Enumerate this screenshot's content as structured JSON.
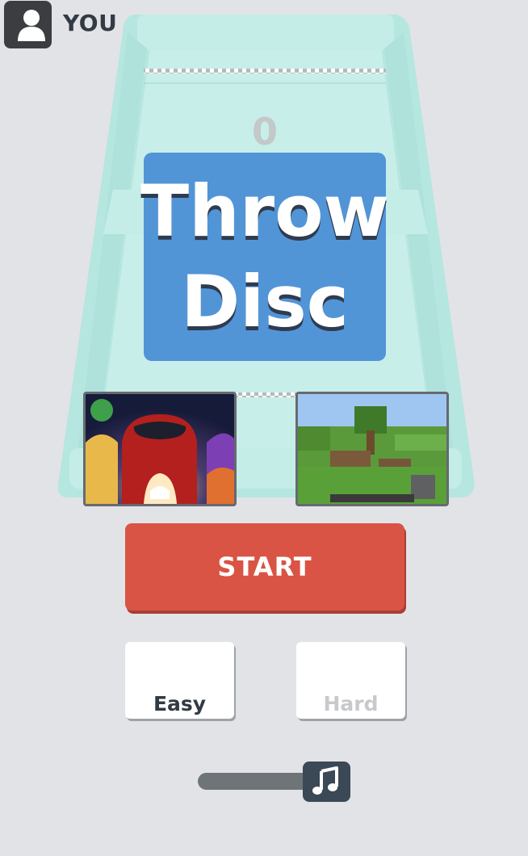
{
  "game": {
    "title_lines": [
      "Throw",
      "Disc"
    ],
    "score": "0"
  },
  "player": {
    "name": "YOU",
    "avatar_icon": "user-silhouette-icon"
  },
  "promos": [
    {
      "name": "among-us-style-thumbnail"
    },
    {
      "name": "minecraft-style-thumbnail"
    }
  ],
  "controls": {
    "start_label": "START",
    "difficulty": [
      {
        "label": "Easy",
        "selected": true
      },
      {
        "label": "Hard",
        "selected": false
      }
    ],
    "music_icon": "music-note-icon"
  },
  "colors": {
    "background": "#e2e3e7",
    "board": "#bde9e3",
    "title_card": "#5195d7",
    "start_button": "#d95444"
  }
}
